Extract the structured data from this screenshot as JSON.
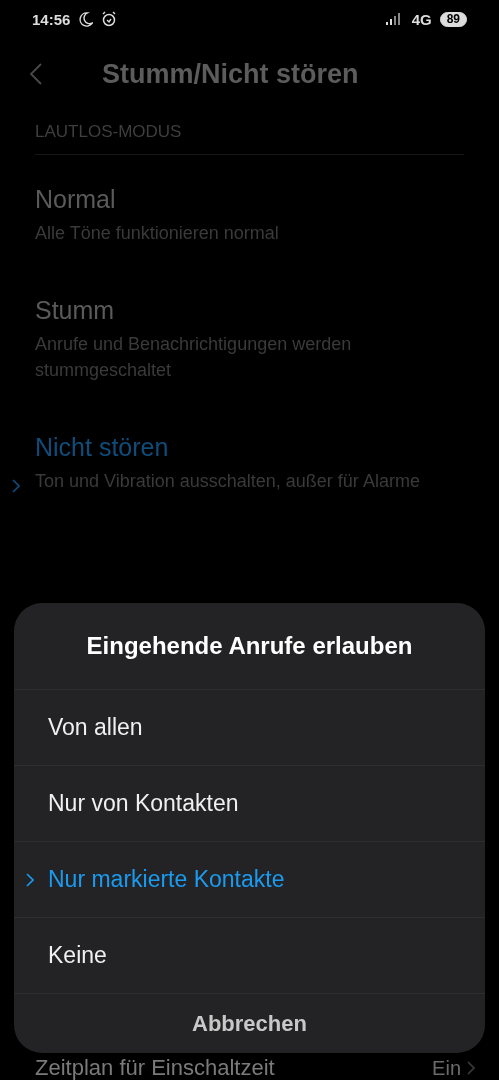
{
  "status_bar": {
    "time": "14:56",
    "network": "4G",
    "battery": "89"
  },
  "header": {
    "title": "Stumm/Nicht stören"
  },
  "section": {
    "label": "LAUTLOS-MODUS"
  },
  "modes": [
    {
      "title": "Normal",
      "subtitle": "Alle Töne funktionieren normal",
      "selected": false
    },
    {
      "title": "Stumm",
      "subtitle": "Anrufe und Benachrichtigungen werden stummgeschaltet",
      "selected": false
    },
    {
      "title": "Nicht stören",
      "subtitle": "Ton und Vibration ausschalten, außer für Alarme",
      "selected": true
    }
  ],
  "bottom_row": {
    "title": "Zeitplan für Einschaltzeit",
    "value": "Ein"
  },
  "dialog": {
    "title": "Eingehende Anrufe erlauben",
    "options": [
      {
        "label": "Von allen",
        "selected": false
      },
      {
        "label": "Nur von Kontakten",
        "selected": false
      },
      {
        "label": "Nur markierte Kontakte",
        "selected": true
      },
      {
        "label": "Keine",
        "selected": false
      }
    ],
    "cancel": "Abbrechen"
  }
}
